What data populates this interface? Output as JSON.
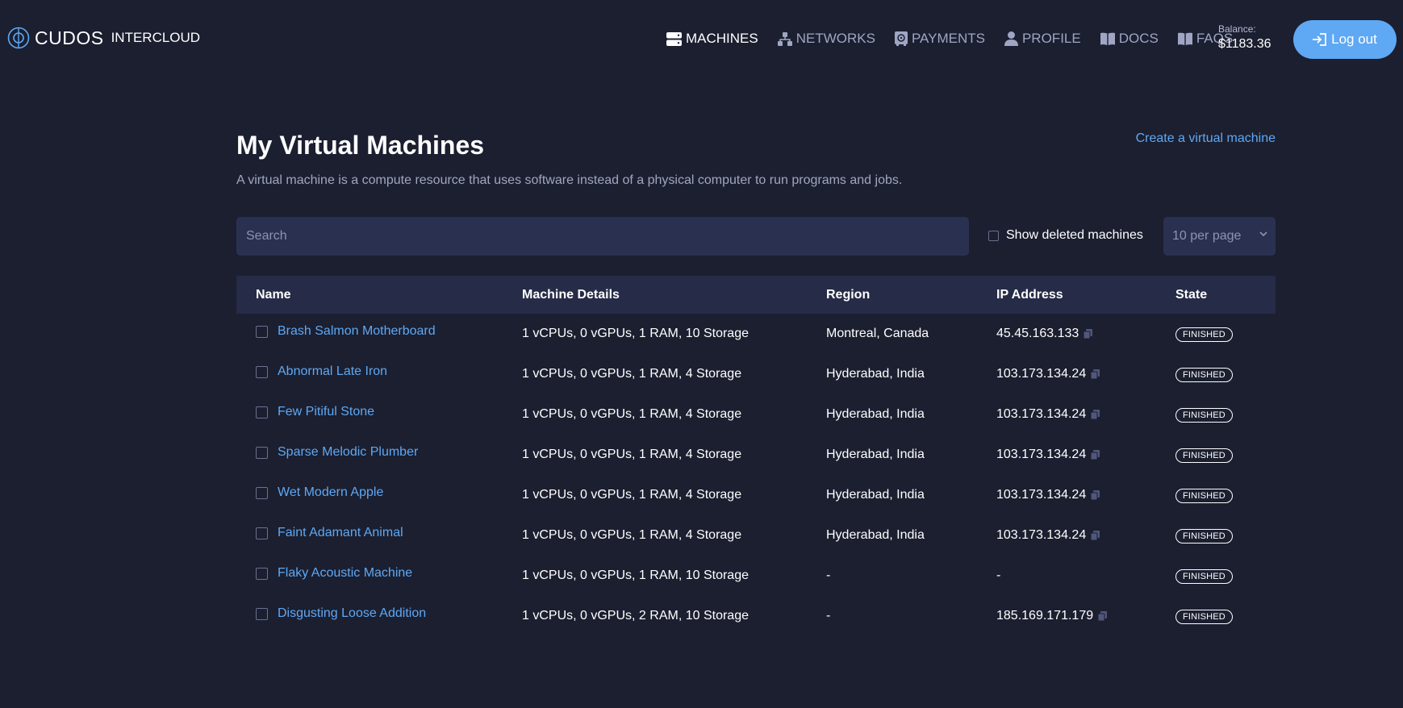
{
  "header": {
    "logo_text": "CUDOS",
    "logo_sub": "INTERCLOUD",
    "nav": [
      {
        "label": "MACHINES",
        "icon": "server-icon",
        "active": true
      },
      {
        "label": "NETWORKS",
        "icon": "network-icon",
        "active": false
      },
      {
        "label": "PAYMENTS",
        "icon": "safe-icon",
        "active": false
      },
      {
        "label": "PROFILE",
        "icon": "user-icon",
        "active": false
      },
      {
        "label": "DOCS",
        "icon": "book-icon",
        "active": false
      },
      {
        "label": "FAQS",
        "icon": "book-icon",
        "active": false
      }
    ],
    "balance_label": "Balance:",
    "balance_value": "$1183.36",
    "logout_label": "Log out"
  },
  "main": {
    "title": "My Virtual Machines",
    "description": "A virtual machine is a compute resource that uses software instead of a physical computer to run programs and jobs.",
    "create_link": "Create a virtual machine",
    "search_placeholder": "Search",
    "show_deleted_label": "Show deleted machines",
    "per_page": "10 per page"
  },
  "table": {
    "columns": {
      "name": "Name",
      "details": "Machine Details",
      "region": "Region",
      "ip": "IP Address",
      "state": "State"
    },
    "rows": [
      {
        "name": "Brash Salmon Motherboard",
        "details": "1 vCPUs, 0 vGPUs, 1 RAM, 10 Storage",
        "region": "Montreal, Canada",
        "ip": "45.45.163.133",
        "has_copy": true,
        "state": "FINISHED"
      },
      {
        "name": "Abnormal Late Iron",
        "details": "1 vCPUs, 0 vGPUs, 1 RAM, 4 Storage",
        "region": "Hyderabad, India",
        "ip": "103.173.134.24",
        "has_copy": true,
        "state": "FINISHED"
      },
      {
        "name": "Few Pitiful Stone",
        "details": "1 vCPUs, 0 vGPUs, 1 RAM, 4 Storage",
        "region": "Hyderabad, India",
        "ip": "103.173.134.24",
        "has_copy": true,
        "state": "FINISHED"
      },
      {
        "name": "Sparse Melodic Plumber",
        "details": "1 vCPUs, 0 vGPUs, 1 RAM, 4 Storage",
        "region": "Hyderabad, India",
        "ip": "103.173.134.24",
        "has_copy": true,
        "state": "FINISHED"
      },
      {
        "name": "Wet Modern Apple",
        "details": "1 vCPUs, 0 vGPUs, 1 RAM, 4 Storage",
        "region": "Hyderabad, India",
        "ip": "103.173.134.24",
        "has_copy": true,
        "state": "FINISHED"
      },
      {
        "name": "Faint Adamant Animal",
        "details": "1 vCPUs, 0 vGPUs, 1 RAM, 4 Storage",
        "region": "Hyderabad, India",
        "ip": "103.173.134.24",
        "has_copy": true,
        "state": "FINISHED"
      },
      {
        "name": "Flaky Acoustic Machine",
        "details": "1 vCPUs, 0 vGPUs, 1 RAM, 10 Storage",
        "region": "-",
        "ip": "-",
        "has_copy": false,
        "state": "FINISHED"
      },
      {
        "name": "Disgusting Loose Addition",
        "details": "1 vCPUs, 0 vGPUs, 2 RAM, 10 Storage",
        "region": "-",
        "ip": "185.169.171.179",
        "has_copy": true,
        "state": "FINISHED"
      }
    ]
  },
  "colors": {
    "background": "#1b1f30",
    "accent": "#5fa8f3",
    "input_bg": "#2a3150",
    "header_row_bg": "#262c47",
    "muted_text": "#a1a6c2"
  }
}
